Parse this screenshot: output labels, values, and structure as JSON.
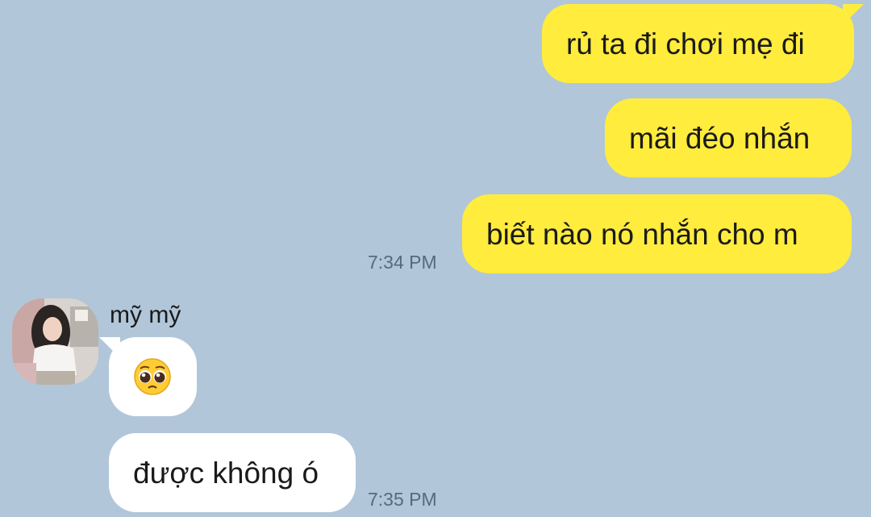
{
  "messages_out": [
    {
      "text": "rủ ta đi chơi mẹ đi"
    },
    {
      "text": "mãi đéo nhắn"
    },
    {
      "text": "biết nào nó nhắn cho m"
    }
  ],
  "time_out": "7:34 PM",
  "sender": {
    "name": "mỹ mỹ",
    "avatar_icon": "profile-photo"
  },
  "messages_in": [
    {
      "emoji": "pleading-face-emoji"
    },
    {
      "text": "được không ó"
    }
  ],
  "time_in": "7:35 PM",
  "colors": {
    "background": "#b1c6d9",
    "outgoing_bubble": "#ffec3d",
    "incoming_bubble": "#ffffff",
    "timestamp": "#566a7e"
  }
}
